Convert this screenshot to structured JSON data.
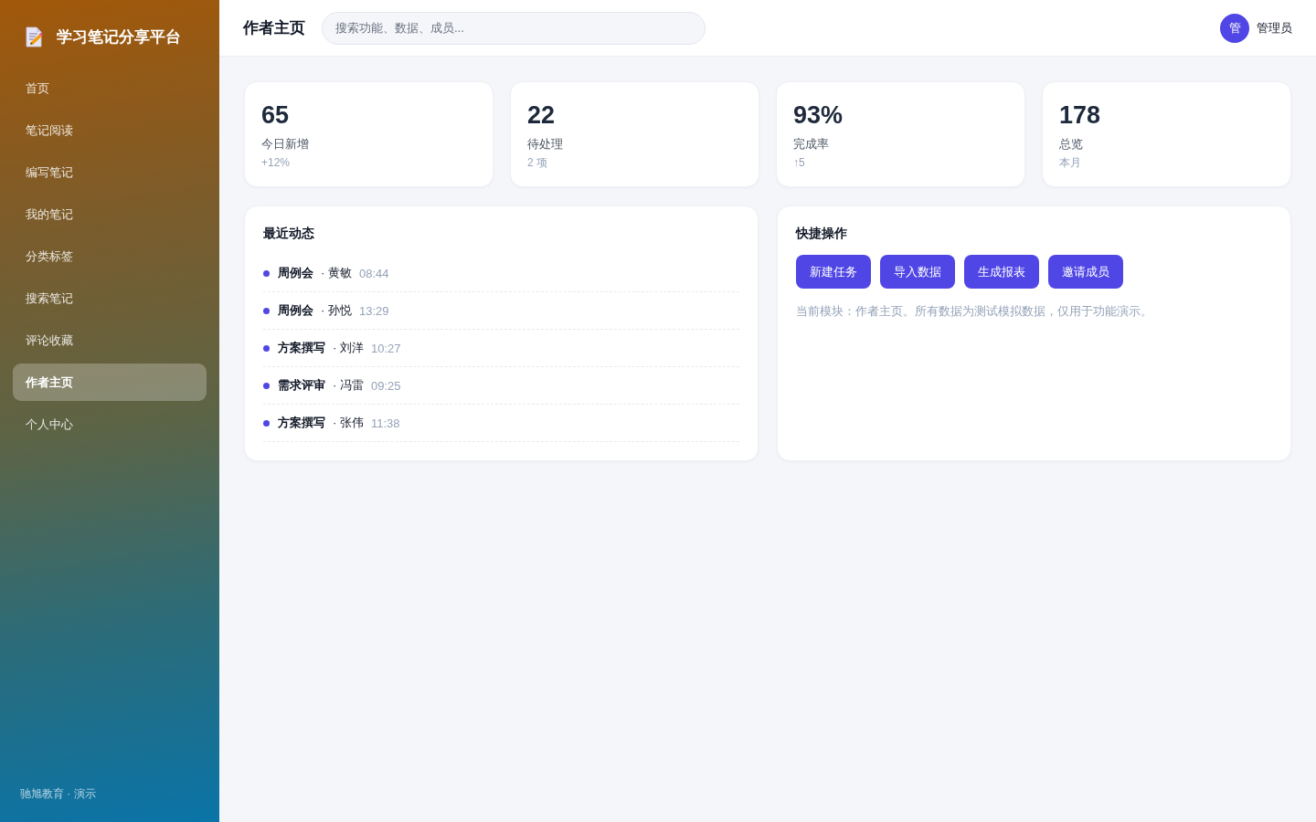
{
  "sidebar": {
    "title": "学习笔记分享平台",
    "items": [
      {
        "label": "首页",
        "selected": false
      },
      {
        "label": "笔记阅读",
        "selected": false
      },
      {
        "label": "编写笔记",
        "selected": false
      },
      {
        "label": "我的笔记",
        "selected": false
      },
      {
        "label": "分类标签",
        "selected": false
      },
      {
        "label": "搜索笔记",
        "selected": false
      },
      {
        "label": "评论收藏",
        "selected": false
      },
      {
        "label": "作者主页",
        "selected": true
      },
      {
        "label": "个人中心",
        "selected": false
      }
    ],
    "footer": "驰旭教育 · 演示"
  },
  "header": {
    "title": "作者主页",
    "search": {
      "placeholder": "搜索功能、数据、成员..."
    },
    "user": {
      "avatar": "管",
      "name": "管理员"
    }
  },
  "stats": [
    {
      "value": "65",
      "label": "今日新增",
      "note": "+12%"
    },
    {
      "value": "22",
      "label": "待处理",
      "note": "2 项"
    },
    {
      "value": "93%",
      "label": "完成率",
      "note": "↑5"
    },
    {
      "value": "178",
      "label": "总览",
      "note": "本月"
    }
  ],
  "activity": {
    "title": "最近动态",
    "items": [
      {
        "event": "周例会",
        "person": "· 黄敏",
        "time": "08:44"
      },
      {
        "event": "周例会",
        "person": "· 孙悦",
        "time": "13:29"
      },
      {
        "event": "方案撰写",
        "person": "· 刘洋",
        "time": "10:27"
      },
      {
        "event": "需求评审",
        "person": "· 冯雷",
        "time": "09:25"
      },
      {
        "event": "方案撰写",
        "person": "· 张伟",
        "time": "11:38"
      }
    ]
  },
  "quick_actions": {
    "title": "快捷操作",
    "buttons": [
      "新建任务",
      "导入数据",
      "生成报表",
      "邀请成员"
    ],
    "note": "当前模块：作者主页。所有数据为测试模拟数据，仅用于功能演示。"
  }
}
